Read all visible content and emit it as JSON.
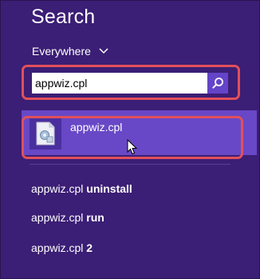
{
  "search": {
    "title": "Search",
    "scope": "Everywhere",
    "query": "appwiz.cpl"
  },
  "results": [
    {
      "label": "appwiz.cpl",
      "icon": "control-panel-file-icon"
    }
  ],
  "suggestions": [
    {
      "prefix": "appwiz.cpl",
      "suffix": "uninstall"
    },
    {
      "prefix": "appwiz.cpl",
      "suffix": "run"
    },
    {
      "prefix": "appwiz.cpl",
      "suffix": "2"
    }
  ],
  "colors": {
    "background": "#3b1e75",
    "highlight": "#6848c6",
    "search_button": "#6444c8",
    "annotation": "#e0505a"
  }
}
